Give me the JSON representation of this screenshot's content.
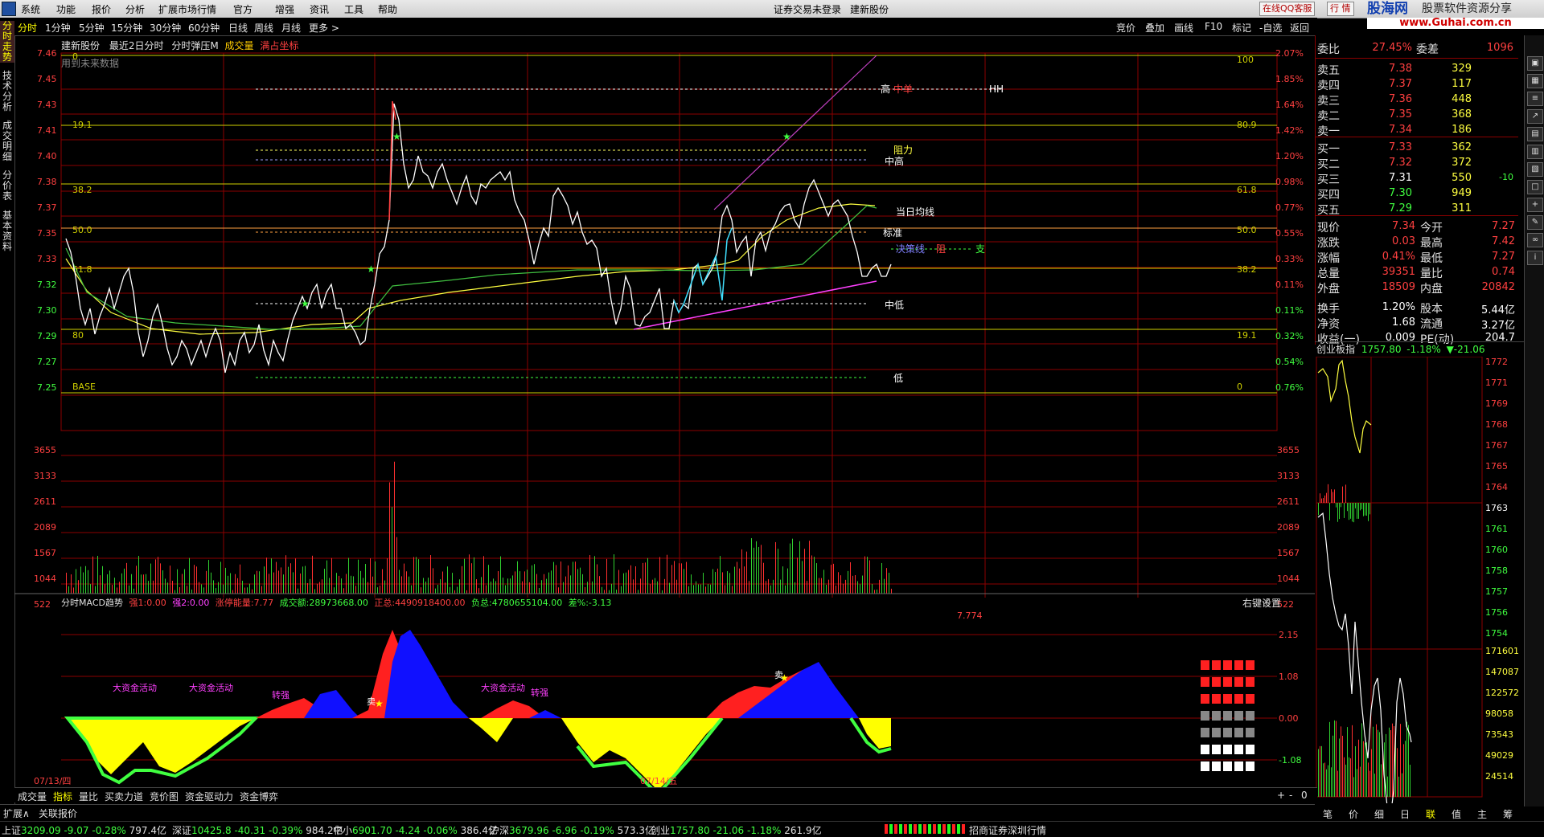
{
  "menu": {
    "items": [
      "系统",
      "功能",
      "报价",
      "分析",
      "扩展市场行情",
      "官方",
      "增强",
      "资讯",
      "工具",
      "帮助"
    ],
    "center": [
      "证券交易未登录",
      "建新股份"
    ],
    "online_btn": "在线QQ客服",
    "trade_btn": "行 情",
    "brand": "股海网",
    "brand_sub": "股票软件资源分享",
    "brand_url": "www.Guhai.com.cn"
  },
  "periods": {
    "items": [
      "分时",
      "1分钟",
      "5分钟",
      "15分钟",
      "30分钟",
      "60分钟",
      "日线",
      "周线",
      "月线",
      "更多 >"
    ],
    "active": 0
  },
  "right_tools": [
    "竞价",
    "叠加",
    "画线",
    "F10",
    "标记",
    "-自选",
    "返回"
  ],
  "left_tabs": [
    "分时走势",
    "技术分析",
    "成交明细",
    "分价表",
    "基本资料"
  ],
  "header": {
    "stock": "建新股份",
    "range": "最近2日分时",
    "formula": "分时弹压M",
    "vol": "成交量",
    "full": "满占坐标",
    "note": "用到未来数据"
  },
  "price_axis": {
    "left": [
      "7.46",
      "7.45",
      "7.43",
      "7.41",
      "7.40",
      "7.38",
      "7.37",
      "7.35",
      "7.33",
      "7.32",
      "7.30",
      "7.29",
      "7.27",
      "7.25"
    ],
    "right": [
      "2.07%",
      "1.85%",
      "1.64%",
      "1.42%",
      "1.20%",
      "0.98%",
      "0.77%",
      "0.55%",
      "0.33%",
      "0.11%",
      "0.11%",
      "0.32%",
      "0.54%",
      "0.76%"
    ],
    "fib_left": [
      "19.1",
      "38.2",
      "50.0",
      "61.8",
      "80",
      "BASE",
      "0"
    ],
    "fib_right": [
      "100",
      "80.9",
      "61.8",
      "50.0",
      "38.2",
      "19.1",
      "0"
    ]
  },
  "annotations": {
    "high": "高",
    "zhongdan": "中单",
    "hh": "HH",
    "zuli": "阻力",
    "zhonggao": "中高",
    "avg": "当日均线",
    "biaozhun": "标准",
    "juece": "决策线",
    "zu": "阻",
    "zhi": "支",
    "zhongdi": "中低",
    "di": "低"
  },
  "vol_axis": [
    "3655",
    "3133",
    "2611",
    "2089",
    "1567",
    "1044",
    "522"
  ],
  "macd": {
    "title": "分时MACD趋势",
    "items": [
      {
        "label": "强1:",
        "value": "0.00",
        "color": "#ff4040"
      },
      {
        "label": "强2:",
        "value": "0.00",
        "color": "#ff40ff"
      },
      {
        "label": "涨停能量:",
        "value": "7.77",
        "color": "#ff4040"
      },
      {
        "label": "成交额:",
        "value": "28973668.00",
        "color": "#40ff40"
      },
      {
        "label": "正总:",
        "value": "4490918400.00",
        "color": "#ff4040"
      },
      {
        "label": "负总:",
        "value": "4780655104.00",
        "color": "#40ff40"
      },
      {
        "label": "差%:",
        "value": "-3.13",
        "color": "#40ff40"
      }
    ],
    "settings": "右键设置",
    "peak": "7.774",
    "axis": [
      "2.15",
      "1.08",
      "0.00",
      "-1.08"
    ],
    "tags": [
      "大资金活动",
      "大资金活动",
      "大资金活动",
      "卖",
      "卖",
      "转强",
      "转强"
    ],
    "dates": [
      "07/13/四",
      "07/14/五"
    ]
  },
  "quote": {
    "weibi_label": "委比",
    "weibi": "27.45%",
    "weicha_label": "委差",
    "weicha": "1096",
    "sell": [
      {
        "label": "卖五",
        "price": "7.38",
        "vol": "329"
      },
      {
        "label": "卖四",
        "price": "7.37",
        "vol": "117"
      },
      {
        "label": "卖三",
        "price": "7.36",
        "vol": "448"
      },
      {
        "label": "卖二",
        "price": "7.35",
        "vol": "368"
      },
      {
        "label": "卖一",
        "price": "7.34",
        "vol": "186"
      }
    ],
    "buy": [
      {
        "label": "买一",
        "price": "7.33",
        "vol": "362",
        "chg": ""
      },
      {
        "label": "买二",
        "price": "7.32",
        "vol": "372",
        "chg": ""
      },
      {
        "label": "买三",
        "price": "7.31",
        "vol": "550",
        "chg": "-10"
      },
      {
        "label": "买四",
        "price": "7.30",
        "vol": "949",
        "chg": ""
      },
      {
        "label": "买五",
        "price": "7.29",
        "vol": "311",
        "chg": ""
      }
    ],
    "stats": [
      {
        "l1": "现价",
        "v1": "7.34",
        "l2": "今开",
        "v2": "7.27"
      },
      {
        "l1": "涨跌",
        "v1": "0.03",
        "l2": "最高",
        "v2": "7.42"
      },
      {
        "l1": "涨幅",
        "v1": "0.41%",
        "l2": "最低",
        "v2": "7.27"
      },
      {
        "l1": "总量",
        "v1": "39351",
        "l2": "量比",
        "v2": "0.74"
      },
      {
        "l1": "外盘",
        "v1": "18509",
        "l2": "内盘",
        "v2": "20842"
      },
      {
        "l1": "换手",
        "v1": "1.20%",
        "l2": "股本",
        "v2": "5.44亿"
      },
      {
        "l1": "净资",
        "v1": "1.68",
        "l2": "流通",
        "v2": "3.27亿"
      },
      {
        "l1": "收益(一)",
        "v1": "0.009",
        "l2": "PE(动)",
        "v2": "204.7"
      }
    ]
  },
  "index": {
    "name": "创业板指",
    "value": "1757.80",
    "pct": "-1.18%",
    "chg": "▼-21.06",
    "axis": [
      "1772",
      "1771",
      "1769",
      "1768",
      "1767",
      "1765",
      "1764",
      "1763",
      "1761",
      "1760",
      "1758",
      "1757",
      "1756",
      "1754"
    ],
    "vol_axis": [
      "171601",
      "147087",
      "122572",
      "98058",
      "73543",
      "49029",
      "24514"
    ]
  },
  "bottom_tabs": [
    "成交量",
    "指标",
    "量比",
    "买卖力道",
    "竞价图",
    "资金驱动力",
    "资金博弈"
  ],
  "bottom_tabs_active": 1,
  "right_bottom_tabs": [
    "笔",
    "价",
    "细",
    "日",
    "联",
    "值",
    "主",
    "筹"
  ],
  "status": {
    "indices": [
      {
        "name": "上证",
        "value": "3209.09",
        "chg": "-9.07",
        "pct": "-0.28%",
        "amt": "797.4亿"
      },
      {
        "name": "深证",
        "value": "10425.8",
        "chg": "-40.31",
        "pct": "-0.39%",
        "amt": "984.2亿"
      },
      {
        "name": "中小",
        "value": "6901.70",
        "chg": "-4.24",
        "pct": "-0.06%",
        "amt": "386.4亿"
      },
      {
        "name": "沪深",
        "value": "3679.96",
        "chg": "-6.96",
        "pct": "-0.19%",
        "amt": "573.3亿"
      },
      {
        "name": "创业",
        "value": "1757.80",
        "chg": "-21.06",
        "pct": "-1.18%",
        "amt": "261.9亿"
      }
    ],
    "broker": "招商证券深圳行情",
    "left1": "扩展∧",
    "left2": "关联报价"
  }
}
